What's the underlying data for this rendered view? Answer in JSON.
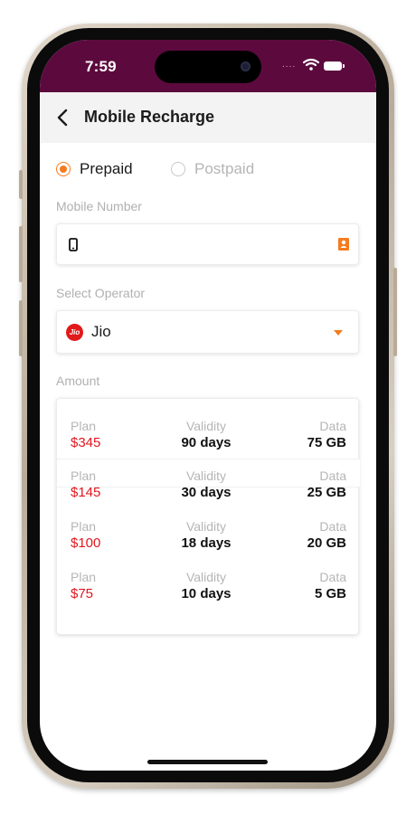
{
  "status_bar": {
    "time": "7:59",
    "signal": "....",
    "wifi_icon": "wifi-icon",
    "battery_icon": "battery-icon"
  },
  "header": {
    "back_icon": "chevron-left-icon",
    "title": "Mobile Recharge"
  },
  "recharge_type": {
    "options": [
      {
        "label": "Prepaid",
        "selected": true
      },
      {
        "label": "Postpaid",
        "selected": false
      }
    ]
  },
  "mobile_number": {
    "label": "Mobile Number",
    "value": "",
    "phone_icon": "phone-icon",
    "contact_icon": "contact-book-icon"
  },
  "operator": {
    "label": "Select Operator",
    "logo_text": "Jio",
    "value": "Jio",
    "dropdown_icon": "caret-down-icon"
  },
  "amount": {
    "label": "Amount"
  },
  "plans": {
    "headers": {
      "plan": "Plan",
      "validity": "Validity",
      "data": "Data"
    },
    "rows": [
      {
        "price": "$345",
        "validity": "90 days",
        "data": "75 GB"
      },
      {
        "price": "$145",
        "validity": "30 days",
        "data": "25 GB"
      },
      {
        "price": "$100",
        "validity": "18 days",
        "data": "20 GB"
      },
      {
        "price": "$75",
        "validity": "10 days",
        "data": "5 GB"
      }
    ]
  },
  "colors": {
    "status_bar": "#5c0a3e",
    "accent": "#f47b20",
    "price": "#e1161e",
    "jio": "#e11a1a"
  }
}
